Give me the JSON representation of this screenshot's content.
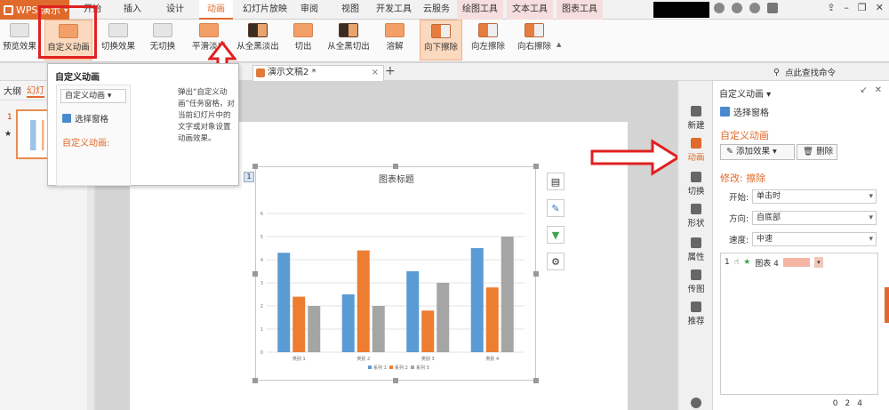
{
  "app": {
    "name": "WPS 演示"
  },
  "menu": {
    "tabs": [
      "开始",
      "插入",
      "设计",
      "动画",
      "幻灯片放映",
      "审阅",
      "视图",
      "开发工具",
      "云服务",
      "绘图工具",
      "文本工具",
      "图表工具"
    ],
    "active": "动画"
  },
  "ribbon": {
    "preview": "预览效果",
    "custom_animation": "自定义动画",
    "switch_effect": "切换效果",
    "none": "无切换",
    "smooth_fade": "平滑淡出",
    "fade_from_black": "从全黑淡出",
    "cut": "切出",
    "cut_from_black": "从全黑切出",
    "dissolve": "溶解",
    "wipe_down": "向下擦除",
    "wipe_left": "向左擦除",
    "wipe_right": "向右擦除"
  },
  "doc_tabs": {
    "active": "演示文稿2 *",
    "search_placeholder": "点此查找命令"
  },
  "left_panel": {
    "tab_outline": "大纲",
    "tab_slides": "幻灯",
    "slide_number": "1"
  },
  "tooltip": {
    "title": "自定义动画",
    "preview_dropdown": "自定义动画",
    "preview_select": "选择窗格",
    "preview_custom": "自定义动画:",
    "description": "弹出“自定义动画”任务窗格，对当前幻灯片中的文字或对象设置动画效果。"
  },
  "chart_data": {
    "type": "bar",
    "title": "图表标题",
    "categories": [
      "类别 1",
      "类别 2",
      "类别 3",
      "类别 4"
    ],
    "series": [
      {
        "name": "系列 1",
        "values": [
          4.3,
          2.5,
          3.5,
          4.5
        ],
        "color": "#5b9bd5"
      },
      {
        "name": "系列 2",
        "values": [
          2.4,
          4.4,
          1.8,
          2.8
        ],
        "color": "#ed7d31"
      },
      {
        "name": "系列 3",
        "values": [
          2.0,
          2.0,
          3.0,
          5.0
        ],
        "color": "#a5a5a5"
      }
    ],
    "ylim": [
      0,
      6
    ],
    "yticks": [
      "0",
      "1",
      "2",
      "3",
      "4",
      "5",
      "6"
    ],
    "grid": true,
    "legend": "bottom"
  },
  "chart_badge": "1",
  "vbar": {
    "items": [
      "新建",
      "动画",
      "切换",
      "形状",
      "属性",
      "传图",
      "推荐"
    ]
  },
  "pane": {
    "header": "自定义动画",
    "select_pane": "选择窗格",
    "custom_animation": "自定义动画",
    "add_effect": "添加效果",
    "delete": "删除",
    "modify": "修改: 擦除",
    "start_label": "开始:",
    "start_value": "单击时",
    "direction_label": "方向:",
    "direction_value": "自底部",
    "speed_label": "速度:",
    "speed_value": "中速",
    "list_item_index": "1",
    "list_item_name": "图表 4",
    "footer_values": [
      "0",
      "2",
      "4"
    ]
  },
  "colors": {
    "accent": "#e06a2b",
    "highlight_red": "#e02020"
  }
}
